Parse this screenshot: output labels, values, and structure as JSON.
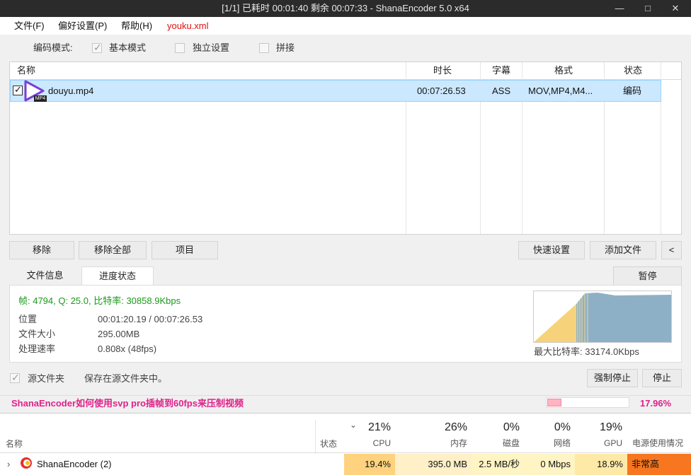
{
  "window": {
    "title": "[1/1] 已耗时 00:01:40  剩余 00:07:33 - ShanaEncoder 5.0 x64",
    "controls": {
      "minimize": "—",
      "maximize": "□",
      "close": "✕"
    }
  },
  "menu": {
    "items": [
      "文件(F)",
      "偏好设置(P)",
      "帮助(H)"
    ],
    "profile": "youku.xml",
    "profile_color": "#e01010"
  },
  "encode_mode": {
    "label": "编码模式:",
    "options": [
      {
        "label": "基本模式",
        "checked": true
      },
      {
        "label": "独立设置",
        "checked": false
      },
      {
        "label": "拼接",
        "checked": false
      }
    ]
  },
  "file_list": {
    "columns": [
      "名称",
      "时长",
      "字幕",
      "格式",
      "状态"
    ],
    "rows": [
      {
        "checked": true,
        "icon": "mp4-play-icon",
        "icon_badge": "MP4",
        "name": "douyu.mp4",
        "duration": "00:07:26.53",
        "subtitle": "ASS",
        "format": "MOV,MP4,M4...",
        "status": "编码"
      }
    ]
  },
  "actions": {
    "remove": "移除",
    "remove_all": "移除全部",
    "item": "项目",
    "quick_settings": "快速设置",
    "add_file": "添加文件",
    "collapse": "<"
  },
  "tabs": {
    "file_info": "文件信息",
    "progress": "进度状态",
    "pause": "暂停"
  },
  "progress": {
    "stats": "帧: 4794, Q: 25.0, 比特率: 30858.9Kbps",
    "stats_color": "#1a9a1a",
    "rows": [
      {
        "label": "位置",
        "value": "00:01:20.19 / 00:07:26.53"
      },
      {
        "label": "文件大小",
        "value": "295.00MB"
      },
      {
        "label": "处理速率",
        "value": "0.808x (48fps)"
      }
    ],
    "max_bitrate": "最大比特率: 33174.0Kbps"
  },
  "output": {
    "source_folder_label": "源文件夹",
    "source_folder_checked": true,
    "message": "保存在源文件夹中。",
    "force_stop": "强制停止",
    "stop": "停止"
  },
  "tip": {
    "text": "ShanaEncoder如何使用svp pro插帧到60fps来压制视频",
    "color": "#e0208a",
    "overall_progress": 0.1796,
    "overall_progress_text": "17.96%"
  },
  "task_manager": {
    "name_header": "名称",
    "status_header": "状态",
    "sort_arrow": "⌄",
    "columns": [
      {
        "pct": "21%",
        "label": "CPU"
      },
      {
        "pct": "26%",
        "label": "内存"
      },
      {
        "pct": "0%",
        "label": "磁盘"
      },
      {
        "pct": "0%",
        "label": "网络"
      },
      {
        "pct": "19%",
        "label": "GPU"
      }
    ],
    "power_header": "电源使用情况",
    "process": {
      "expand": "›",
      "icon": "shana-encoder-icon",
      "name": "ShanaEncoder (2)",
      "cpu": "19.4%",
      "memory": "395.0 MB",
      "disk": "2.5 MB/秒",
      "network": "0 Mbps",
      "gpu": "18.9%",
      "power": "非常高"
    },
    "colors": {
      "cpu": "#ffd27f",
      "memory": "#fff0c8",
      "disk": "#fff4c4",
      "network": "#fff4c4",
      "gpu": "#ffe9a6",
      "power": "#f7761f"
    }
  }
}
